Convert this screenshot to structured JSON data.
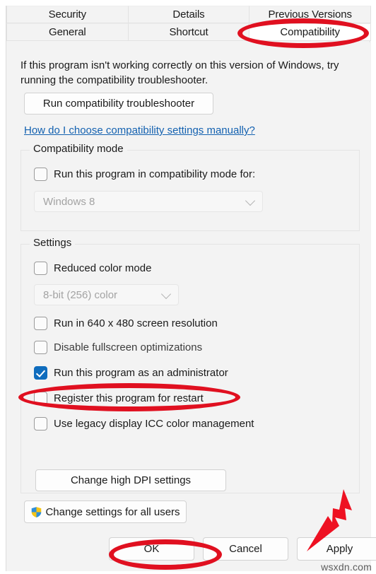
{
  "dialog": {
    "tabs_row1": [
      {
        "label": "Security",
        "selected": false
      },
      {
        "label": "Details",
        "selected": false
      },
      {
        "label": "Previous Versions",
        "selected": false
      }
    ],
    "tabs_row2": [
      {
        "label": "General",
        "selected": false
      },
      {
        "label": "Shortcut",
        "selected": false
      },
      {
        "label": "Compatibility",
        "selected": true
      }
    ],
    "intro_text": "If this program isn't working correctly on this version of Windows, try running the compatibility troubleshooter.",
    "run_troubleshooter_label": "Run compatibility troubleshooter",
    "manual_settings_link": "How do I choose compatibility settings manually?",
    "compatibility_mode": {
      "title": "Compatibility mode",
      "checkbox_label": "Run this program in compatibility mode for:",
      "checkbox_checked": false,
      "combo_value": "Windows 8",
      "combo_enabled": false
    },
    "settings": {
      "title": "Settings",
      "reduced_color_label": "Reduced color mode",
      "reduced_color_checked": false,
      "color_depth_value": "8-bit (256) color",
      "color_depth_enabled": false,
      "checkboxes": [
        {
          "label": "Run in 640 x 480 screen resolution",
          "checked": false
        },
        {
          "label": "Disable fullscreen optimizations",
          "checked": false
        },
        {
          "label": "Run this program as an administrator",
          "checked": true
        },
        {
          "label": "Register this program for restart",
          "checked": false
        },
        {
          "label": "Use legacy display ICC color management",
          "checked": false
        }
      ],
      "change_dpi_label": "Change high DPI settings"
    },
    "change_all_users_label": "Change settings for all users",
    "footer": {
      "ok_label": "OK",
      "cancel_label": "Cancel",
      "apply_label": "Apply"
    }
  },
  "annotations": {
    "highlight_color": "#e01020",
    "arrow_color": "#ee1122",
    "watermark": "wsxdn.com"
  }
}
